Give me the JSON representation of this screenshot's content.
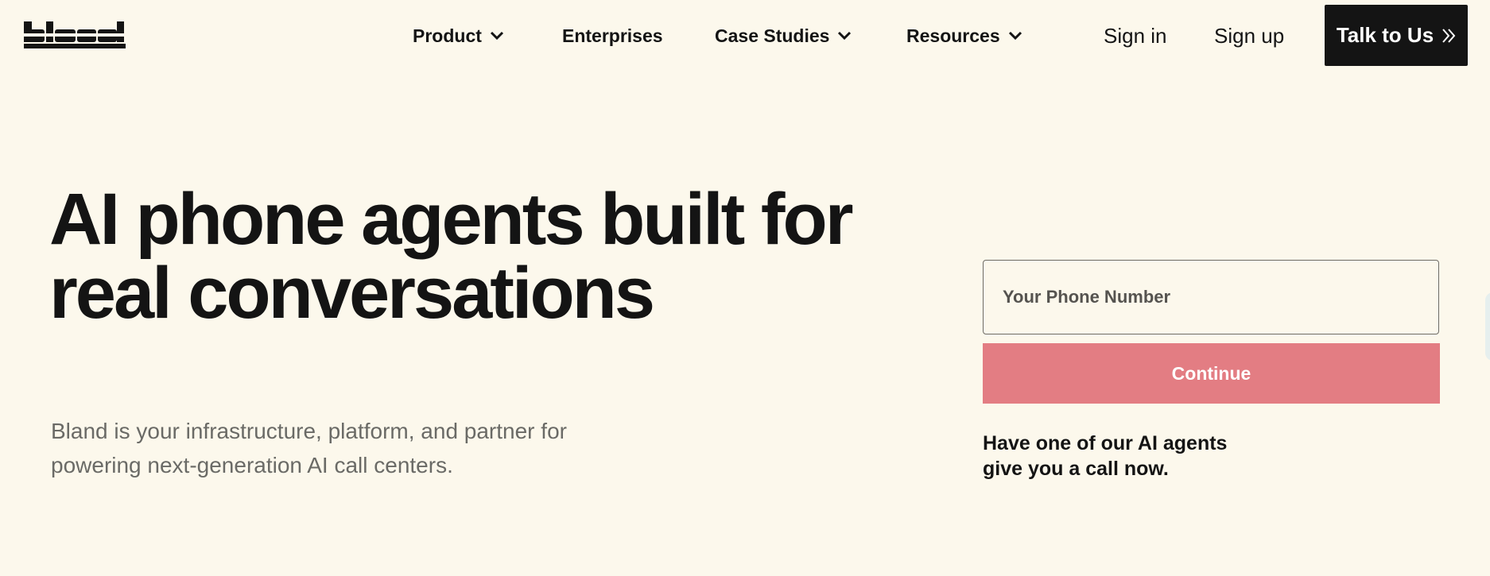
{
  "brand": {
    "logo_text": "bland"
  },
  "nav": {
    "items": [
      {
        "label": "Product",
        "has_dropdown": true
      },
      {
        "label": "Enterprises",
        "has_dropdown": false
      },
      {
        "label": "Case Studies",
        "has_dropdown": true
      },
      {
        "label": "Resources",
        "has_dropdown": true
      }
    ],
    "sign_in": "Sign in",
    "sign_up": "Sign up",
    "cta_label": "Talk to Us",
    "cta_icon": "double-chevron-right-icon"
  },
  "hero": {
    "headline_line1": "AI phone agents built for",
    "headline_line2": "real conversations",
    "subtext_line1": "Bland is your infrastructure, platform, and partner for",
    "subtext_line2": "powering next-generation AI call centers."
  },
  "call_form": {
    "phone_placeholder": "Your Phone Number",
    "phone_value": "",
    "continue_label": "Continue",
    "note_line1": "Have one of our AI agents",
    "note_line2": "give you a call now."
  },
  "colors": {
    "background": "#fcf8ec",
    "text": "#141414",
    "cta_background": "#141414",
    "continue_button": "#e37d83",
    "muted_text": "#6a6a66"
  }
}
